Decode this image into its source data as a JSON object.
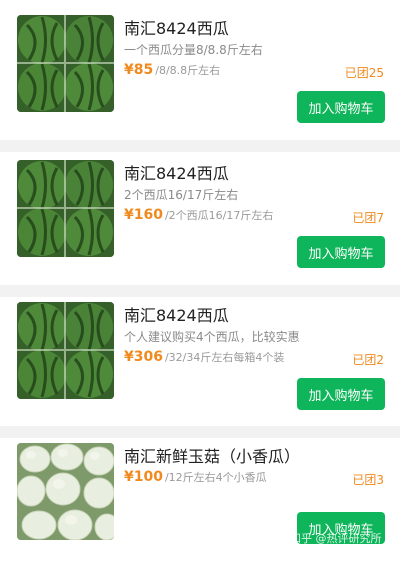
{
  "products": [
    {
      "title": "南汇8424西瓜",
      "desc": "一个西瓜分量8/8.8斤左右",
      "price": "¥85",
      "price_unit": "/8/8.8斤左右",
      "sold": "已团25",
      "button": "加入购物车",
      "image": "watermelon"
    },
    {
      "title": "南汇8424西瓜",
      "desc": "2个西瓜16/17斤左右",
      "price": "¥160",
      "price_unit": "/2个西瓜16/17斤左右",
      "sold": "已团7",
      "button": "加入购物车",
      "image": "watermelon"
    },
    {
      "title": "南汇8424西瓜",
      "desc": "个人建议购买4个西瓜，比较实惠",
      "price": "¥306",
      "price_unit": "/32/34斤左右每箱4个装",
      "sold": "已团2",
      "button": "加入购物车",
      "image": "watermelon"
    },
    {
      "title": "南汇新鲜玉菇（小香瓜）",
      "desc": "",
      "price": "¥100",
      "price_unit": "/12斤左右4个小香瓜",
      "sold": "已团3",
      "button": "加入购物车",
      "image": "melon"
    }
  ],
  "watermark": "知乎 @热评研究所",
  "colors": {
    "price": "#f08a1e",
    "button": "#0fb55a",
    "separator": "#f2f2f2"
  }
}
